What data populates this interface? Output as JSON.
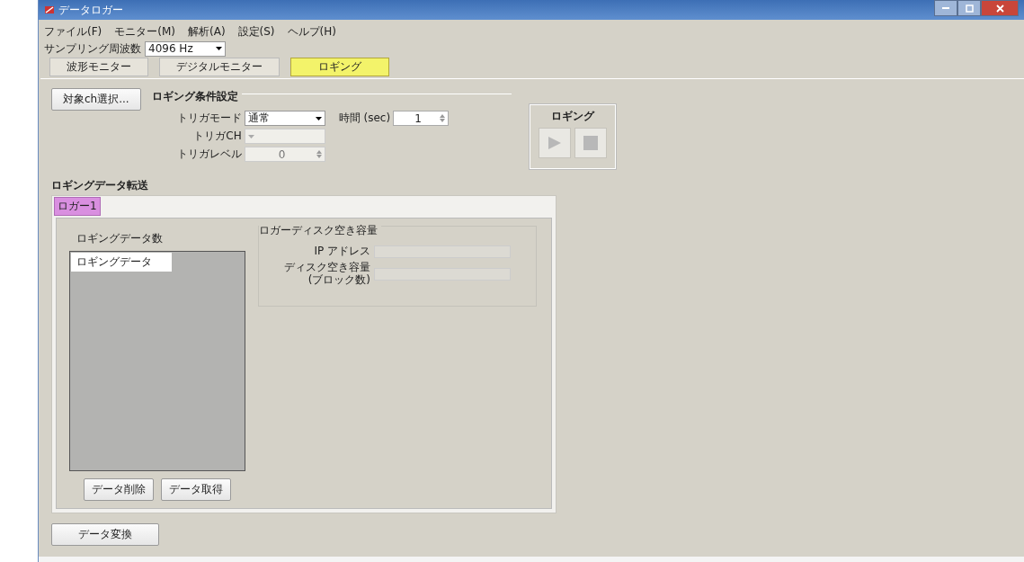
{
  "window": {
    "title": "データロガー"
  },
  "menu": [
    {
      "label": "ファイル(F)"
    },
    {
      "label": "モニター(M)"
    },
    {
      "label": "解析(A)"
    },
    {
      "label": "設定(S)"
    },
    {
      "label": "ヘルプ(H)"
    }
  ],
  "sampling": {
    "label": "サンプリング周波数",
    "value": "4096 Hz"
  },
  "tabs": [
    {
      "label": "波形モニター",
      "selected": false
    },
    {
      "label": "デジタルモニター",
      "selected": false
    },
    {
      "label": "ロギング",
      "selected": true
    }
  ],
  "select_channels_button": "対象ch選択...",
  "logging_conditions": {
    "title": "ロギング条件設定",
    "trigger_mode": {
      "label": "トリガモード",
      "value": "通常",
      "disabled": false
    },
    "time": {
      "label": "時間 (sec)",
      "value": "1"
    },
    "trigger_ch": {
      "label": "トリガCH",
      "disabled": true
    },
    "trigger_level": {
      "label": "トリガレベル",
      "value": "0",
      "disabled": true
    }
  },
  "logging_control": {
    "title": "ロギング",
    "buttons": [
      {
        "kind": "play",
        "disabled": true
      },
      {
        "kind": "stop",
        "disabled": true
      }
    ]
  },
  "transfer": {
    "title": "ロギングデータ転送",
    "tabs": [
      {
        "label": "ロガー1",
        "selected": true
      }
    ],
    "count_label": "ロギングデータ数",
    "list": {
      "columns": [
        "ロギングデータ"
      ]
    },
    "disk": {
      "title": "ロガーディスク空き容量",
      "fields": [
        {
          "label": "IP アドレス",
          "disabled": true
        },
        {
          "label": "ディスク空き容量\n(ブロック数)",
          "disabled": true
        }
      ]
    },
    "buttons": [
      "データ削除",
      "データ取得"
    ]
  },
  "convert_button": "データ変換"
}
